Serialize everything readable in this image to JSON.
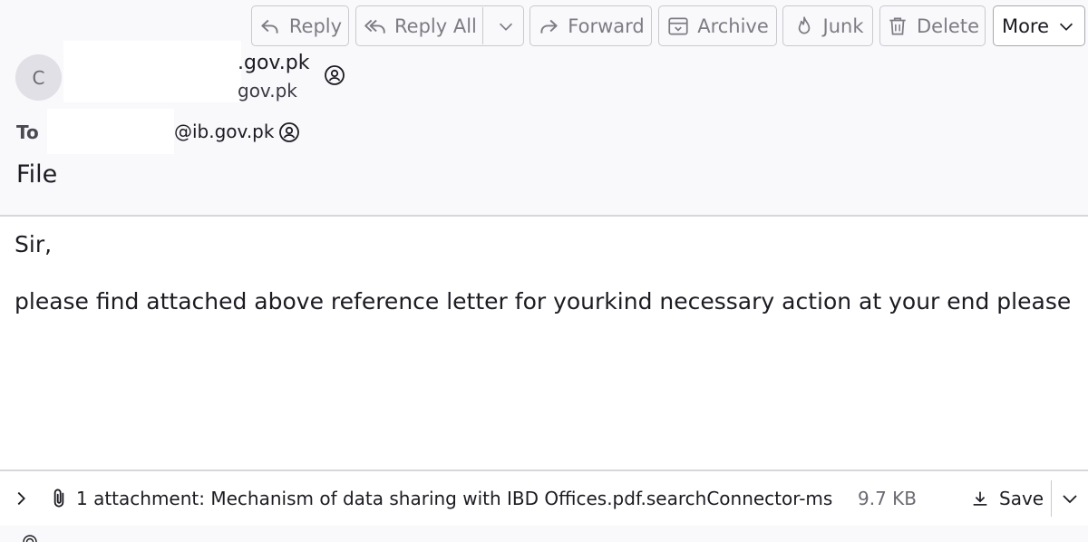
{
  "toolbar": {
    "reply": "Reply",
    "reply_all": "Reply All",
    "forward": "Forward",
    "archive": "Archive",
    "junk": "Junk",
    "delete": "Delete",
    "more": "More"
  },
  "message": {
    "avatar_initial": "C",
    "from_name": ".gov.pk",
    "from_address": "gov.pk",
    "to_label": "To",
    "to_address": "@ib.gov.pk",
    "subject": "File"
  },
  "body": {
    "greeting": "Sir,",
    "text": "please find attached above reference letter for yourkind necessary action at your end please"
  },
  "attachments": {
    "summary": "1 attachment: Mechanism of data sharing with IBD Offices.pdf.searchConnector-ms",
    "size": "9.7 KB",
    "save_label": "Save"
  },
  "colors": {
    "header_bg": "#f9f9fb",
    "border": "#d7d7db",
    "disabled_text": "#7c7c84",
    "text": "#1c1b22"
  }
}
